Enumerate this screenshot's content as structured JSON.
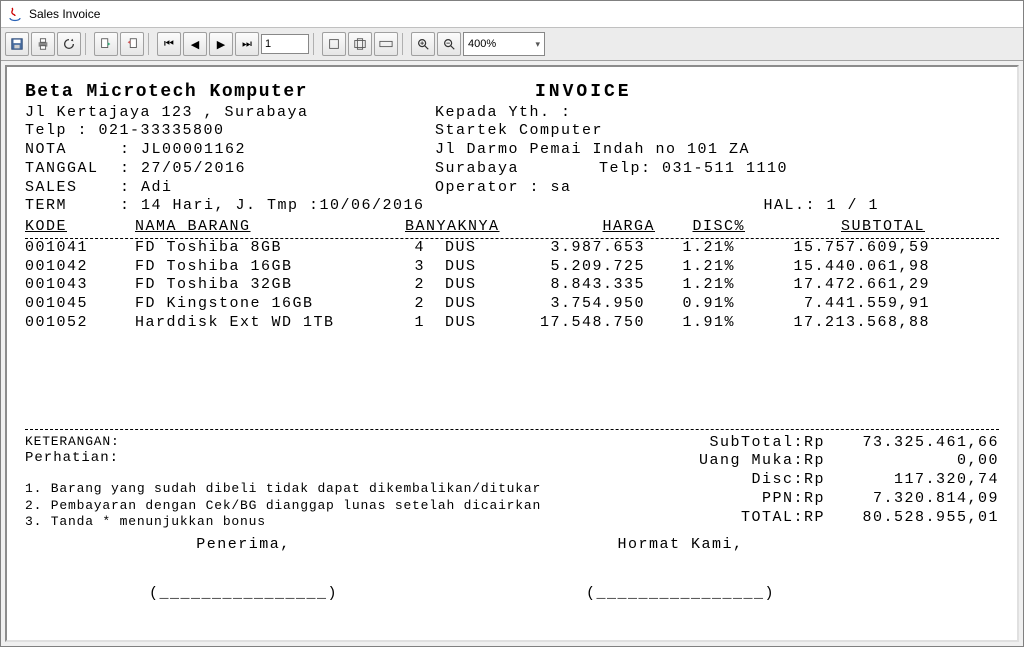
{
  "window": {
    "title": "Sales Invoice"
  },
  "toolbar": {
    "page_input": "1",
    "zoom_value": "400%"
  },
  "company": {
    "name": "Beta Microtech Komputer",
    "doc_type": "INVOICE",
    "address": "Jl Kertajaya 123 , Surabaya",
    "phone_label": "Telp : ",
    "phone": "021-33335800"
  },
  "recipient": {
    "kepada": "Kepada Yth. :",
    "name": "Startek Computer",
    "address": "Jl Darmo Pemai Indah no 101 ZA",
    "city": "Surabaya",
    "phone_label": "Telp: ",
    "phone": "031-511 1110",
    "operator_label": "Operator : ",
    "operator": "sa",
    "hal_label": "HAL.: ",
    "hal": "1 / 1"
  },
  "meta": {
    "nota_label": "NOTA",
    "nota": "JL00001162",
    "tanggal_label": "TANGGAL",
    "tanggal": "27/05/2016",
    "sales_label": "SALES",
    "sales": "Adi",
    "term_label": "TERM",
    "term": "14 Hari, J. Tmp :10/06/2016"
  },
  "headers": {
    "kode": "KODE",
    "nama": "NAMA BARANG",
    "qty": "BANYAKNYA",
    "harga": "HARGA",
    "disc": "DISC%",
    "sub": "SUBTOTAL"
  },
  "items": [
    {
      "kode": "001041",
      "nama": "FD Toshiba 8GB",
      "qty": "4",
      "unit": "DUS",
      "harga": "3.987.653",
      "disc": "1.21%",
      "sub": "15.757.609,59"
    },
    {
      "kode": "001042",
      "nama": "FD Toshiba 16GB",
      "qty": "3",
      "unit": "DUS",
      "harga": "5.209.725",
      "disc": "1.21%",
      "sub": "15.440.061,98"
    },
    {
      "kode": "001043",
      "nama": "FD Toshiba 32GB",
      "qty": "2",
      "unit": "DUS",
      "harga": "8.843.335",
      "disc": "1.21%",
      "sub": "17.472.661,29"
    },
    {
      "kode": "001045",
      "nama": "FD Kingstone 16GB",
      "qty": "2",
      "unit": "DUS",
      "harga": "3.754.950",
      "disc": "0.91%",
      "sub": "7.441.559,91"
    },
    {
      "kode": "001052",
      "nama": "Harddisk Ext WD 1TB",
      "qty": "1",
      "unit": "DUS",
      "harga": "17.548.750",
      "disc": "1.91%",
      "sub": "17.213.568,88"
    }
  ],
  "footer": {
    "keterangan_label": "KETERANGAN:",
    "perhatian_label": "Perhatian:",
    "note1": "1. Barang yang sudah dibeli tidak dapat dikembalikan/ditukar",
    "note2": "2. Pembayaran dengan Cek/BG dianggap lunas setelah dicairkan",
    "note3": "3. Tanda * menunjukkan bonus",
    "penerima": "Penerima,",
    "hormat": "Hormat Kami,",
    "sign_blank": "(________________)"
  },
  "totals": {
    "subtotal_label": "SubTotal:Rp",
    "subtotal": "73.325.461,66",
    "uang_muka_label": "Uang Muka:Rp",
    "uang_muka": "0,00",
    "disc_label": "Disc:Rp",
    "disc": "117.320,74",
    "ppn_label": "PPN:Rp",
    "ppn": "7.320.814,09",
    "total_label": "TOTAL:RP",
    "total": "80.528.955,01"
  }
}
